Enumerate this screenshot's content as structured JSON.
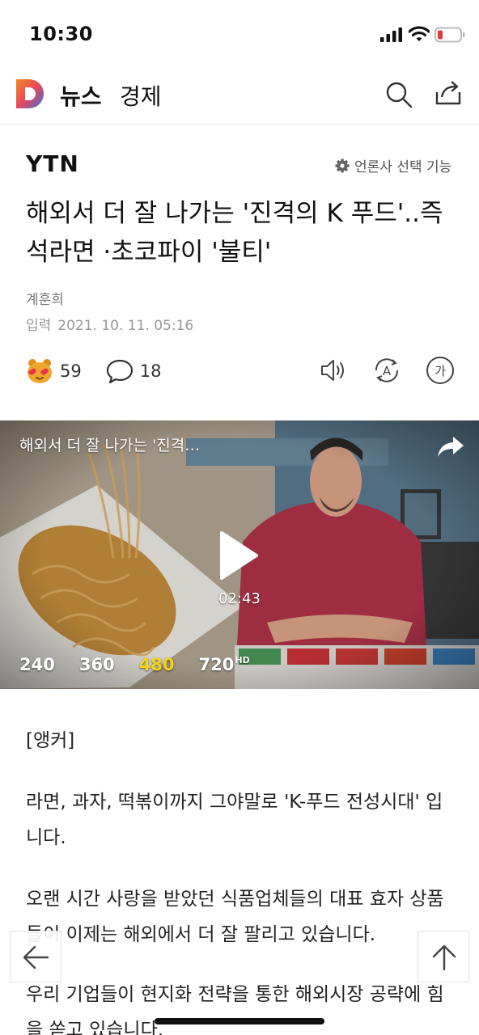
{
  "status_bar": {
    "time": "10:30"
  },
  "header": {
    "news": "뉴스",
    "section": "경제"
  },
  "article": {
    "publisher": "YTN",
    "publisher_select": "언론사 선택 기능",
    "title": "해외서 더 잘 나가는 '진격의 K 푸드'..즉석라면 ·초코파이 '불티'",
    "reporter": "계훈희",
    "date_label": "입력",
    "date": "2021. 10. 11. 05:16",
    "reaction_count": "59",
    "comment_count": "18"
  },
  "video": {
    "title": "해외서 더 잘 나가는 '진격…",
    "duration": "02:43",
    "qualities": [
      {
        "label": "240",
        "hd": ""
      },
      {
        "label": "360",
        "hd": ""
      },
      {
        "label": "480",
        "hd": "",
        "selected": true
      },
      {
        "label": "720",
        "hd": "HD"
      }
    ]
  },
  "body": {
    "p1": "[앵커]",
    "p2": "라면, 과자, 떡볶이까지 그야말로 'K-푸드 전성시대' 입니다.",
    "p3": "오랜 시간 사랑을 받았던 식품업체들의 대표 효자 상품들이 이제는 해외에서 더 잘 팔리고 있습니다.",
    "p4": "우리 기업들이 현지화 전략을 통한 해외시장 공략에 힘을 쏟고 있습니다."
  },
  "colors": {
    "accent_yellow": "#f5d418",
    "logo_orange": "#f08a24",
    "logo_blue": "#3c6fd8"
  }
}
